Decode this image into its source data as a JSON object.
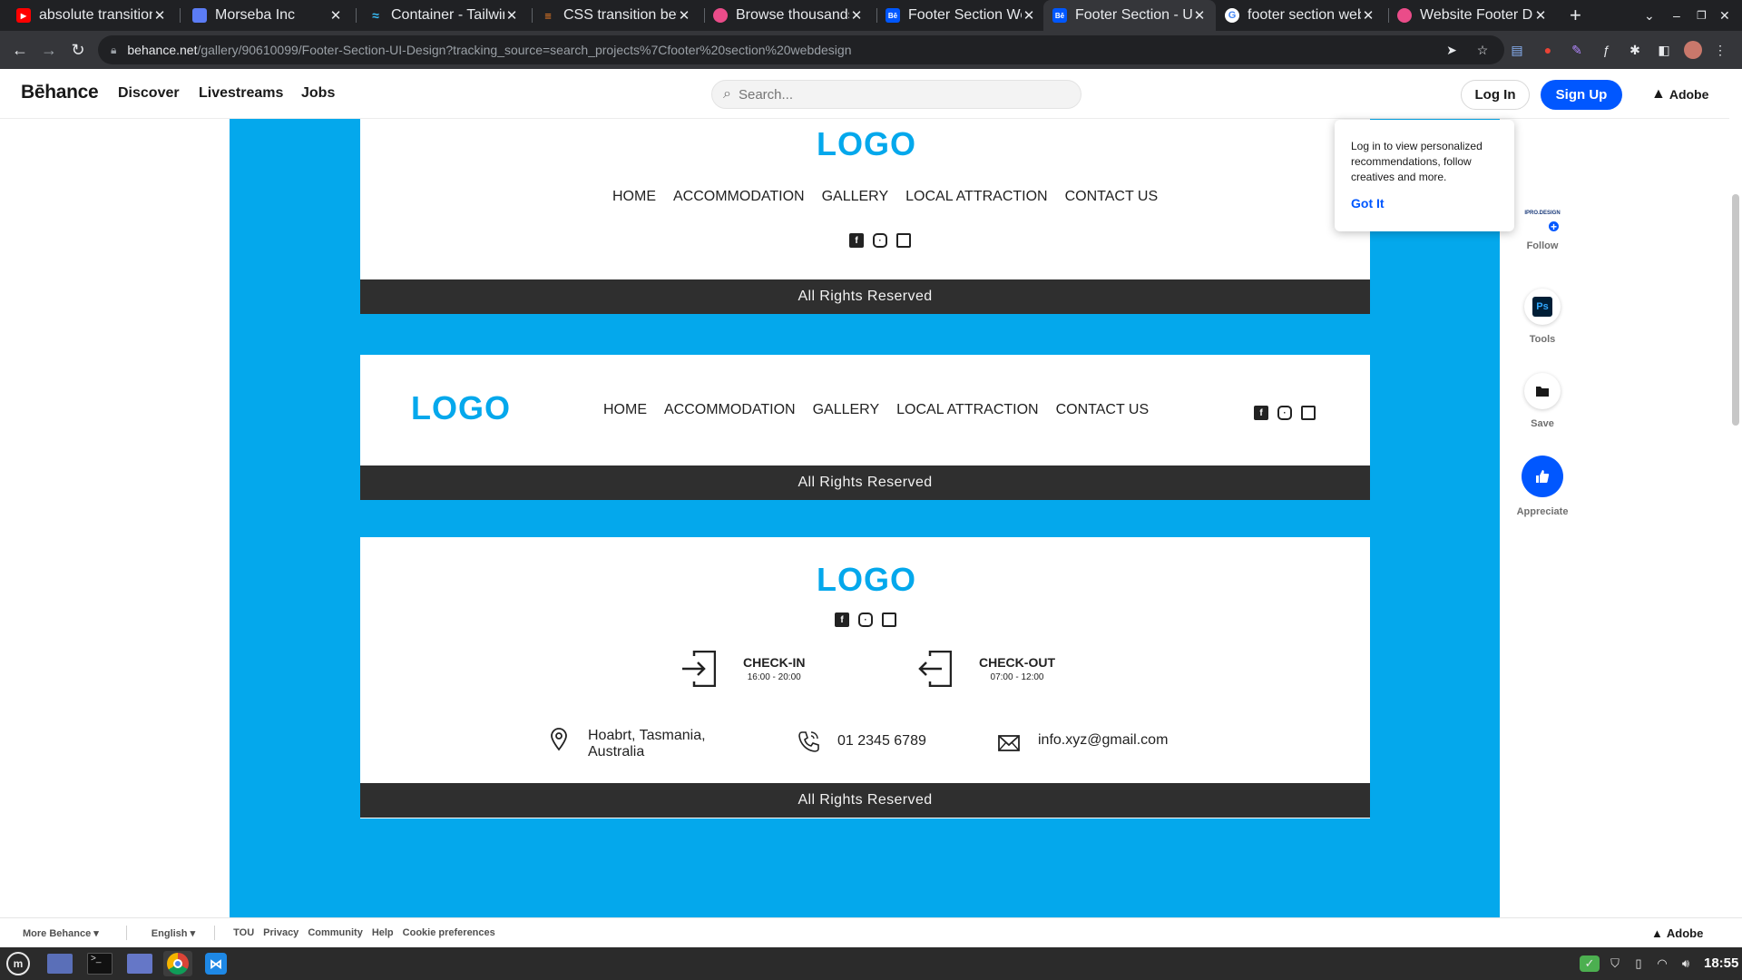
{
  "browser": {
    "tabs": [
      {
        "title": "absolute transition",
        "favicon": "youtube-icon",
        "favicon_color": "#ff0000"
      },
      {
        "title": "Morseba Inc",
        "favicon": "morseba-icon",
        "favicon_color": "#5b7cf5"
      },
      {
        "title": "Container - Tailwind",
        "favicon": "tailwind-icon",
        "favicon_color": "#38bdf8"
      },
      {
        "title": "CSS transition betw",
        "favicon": "stackoverflow-icon",
        "favicon_color": "#f48024"
      },
      {
        "title": "Browse thousands",
        "favicon": "dribbble-icon",
        "favicon_color": "#ea4c89"
      },
      {
        "title": "Footer Section We",
        "favicon": "behance-icon",
        "favicon_color": "#0057ff"
      },
      {
        "title": "Footer Section - U",
        "favicon": "behance-icon",
        "favicon_color": "#0057ff",
        "active": true
      },
      {
        "title": "footer section web",
        "favicon": "google-icon",
        "favicon_color": "#4285f4"
      },
      {
        "title": "Website Footer De",
        "favicon": "dribbble-icon",
        "favicon_color": "#ea4c89"
      }
    ],
    "new_tab_label": "+",
    "url_host": "behance.net",
    "url_path": "/gallery/90610099/Footer-Section-UI-Design?tracking_source=search_projects%7Cfooter%20section%20webdesign"
  },
  "behance": {
    "logo": "Bēhance",
    "nav": [
      "Discover",
      "Livestreams",
      "Jobs"
    ],
    "search_placeholder": "Search...",
    "login_label": "Log In",
    "signup_label": "Sign Up",
    "adobe_label": "Adobe",
    "accent_color": "#0057ff"
  },
  "footer_designs": {
    "brand_color": "#04a8ec",
    "logo_text": "LOGO",
    "nav_items": [
      "HOME",
      "ACCOMMODATION",
      "GALLERY",
      "LOCAL ATTRACTION",
      "CONTACT US"
    ],
    "rights": "All Rights Reserved",
    "checkin": {
      "label": "CHECK-IN",
      "time": "16:00 - 20:00"
    },
    "checkout": {
      "label": "CHECK-OUT",
      "time": "07:00 - 12:00"
    },
    "address_line1": "Hoabrt, Tasmania,",
    "address_line2": "Australia",
    "phone": "01 2345 6789",
    "email": "info.xyz@gmail.com"
  },
  "tooltip": {
    "message": "Log in to view personalized recommendations, follow creatives and more.",
    "button": "Got It"
  },
  "rail": {
    "follow_label": "Follow",
    "owner_badge": "IPRO.DESIGN",
    "tools_label": "Tools",
    "tool_name": "Ps",
    "save_label": "Save",
    "appreciate_label": "Appreciate"
  },
  "site_footer": {
    "more_behance": "More Behance",
    "language": "English",
    "links": [
      "TOU",
      "Privacy",
      "Community",
      "Help",
      "Cookie preferences"
    ],
    "adobe_label": "Adobe"
  },
  "taskbar": {
    "clock": "18:55"
  }
}
